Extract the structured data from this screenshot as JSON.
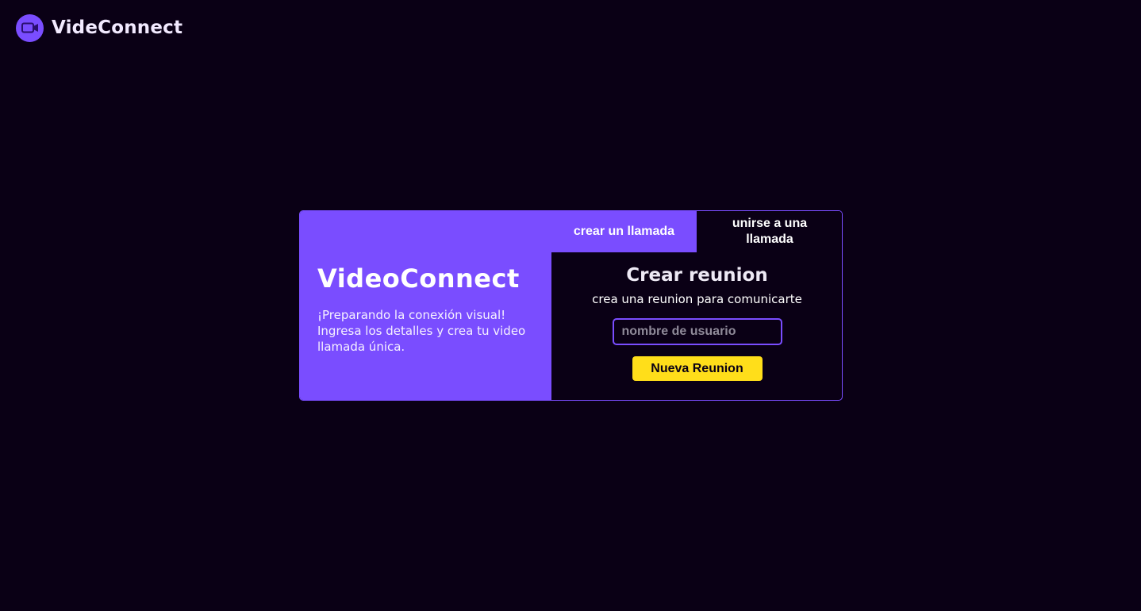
{
  "header": {
    "logo_icon": "video-camera-icon",
    "brand": "VideConnect"
  },
  "tabs": [
    {
      "label": "crear un llamada",
      "active": true
    },
    {
      "label": "unirse a una llamada",
      "active": false
    }
  ],
  "left_panel": {
    "title": "VideoConnect",
    "description": "¡Preparando la conexión visual! Ingresa los detalles y crea tu video llamada única."
  },
  "form": {
    "title": "Crear reunion",
    "subtitle": "crea una reunion para comunicarte",
    "username_placeholder": "nombre de usuario",
    "username_value": "",
    "submit_label": "Nueva Reunion"
  },
  "colors": {
    "background": "#0a0015",
    "accent": "#7a4dff",
    "button": "#ffde1a"
  }
}
